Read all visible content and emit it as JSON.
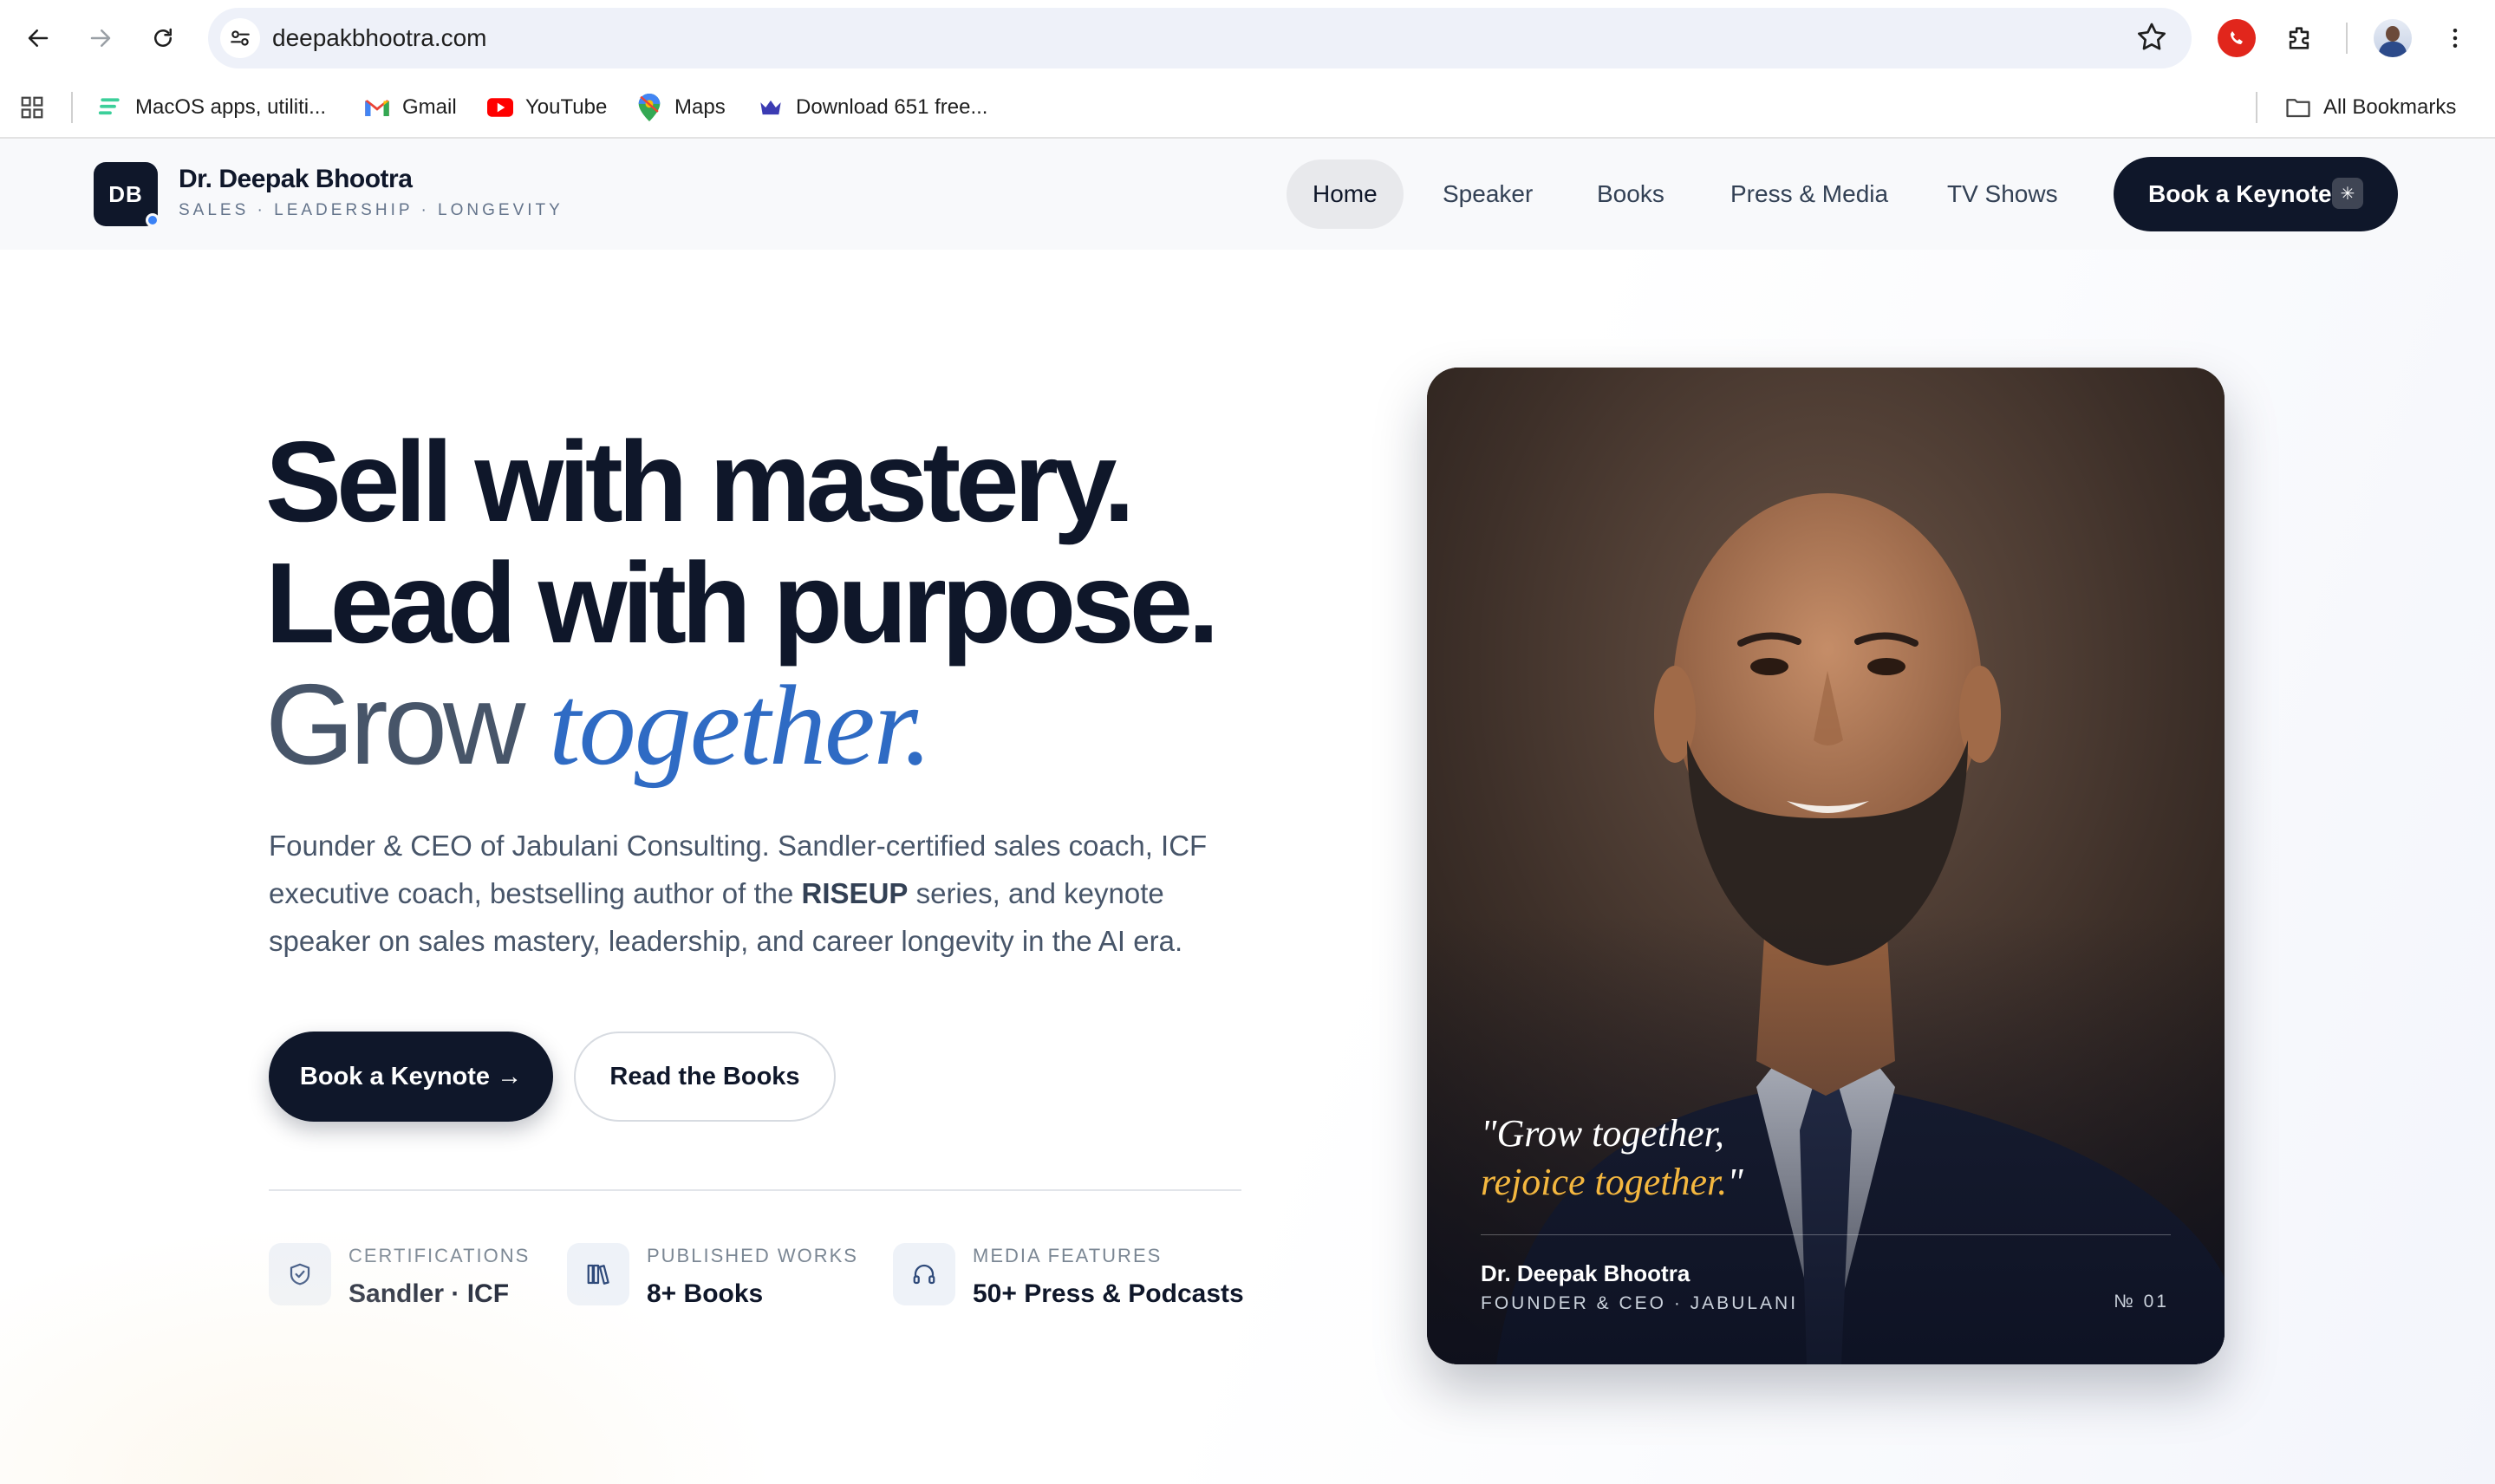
{
  "browser": {
    "url": "deepakbhootra.com",
    "bookmarks": [
      {
        "label": "MacOS apps, utiliti...",
        "icon": "setapp-icon"
      },
      {
        "label": "Gmail",
        "icon": "gmail-icon"
      },
      {
        "label": "YouTube",
        "icon": "youtube-icon"
      },
      {
        "label": "Maps",
        "icon": "maps-icon"
      },
      {
        "label": "Download 651 free...",
        "icon": "crown-icon"
      }
    ],
    "all_bookmarks": "All Bookmarks"
  },
  "site": {
    "logo": "DB",
    "name": "Dr. Deepak Bhootra",
    "tagline": "SALES · LEADERSHIP · LONGEVITY",
    "nav": [
      "Home",
      "Speaker",
      "Books",
      "Press & Media",
      "TV Shows"
    ],
    "nav_active": "Home",
    "cta": "Book a Keynote"
  },
  "hero": {
    "line1": "Sell with mastery.",
    "line2": "Lead with purpose.",
    "line3_plain": "Grow ",
    "line3_accent": "together.",
    "lede_before": "Founder & CEO of Jabulani Consulting. Sandler-certified sales coach, ICF executive coach, bestselling author of the ",
    "lede_bold": "RISEUP",
    "lede_after": " series, and keynote speaker on sales mastery, leadership, and career longevity in the AI era.",
    "primary_button": "Book a Keynote →",
    "secondary_button": "Read the Books",
    "stats": [
      {
        "label": "CERTIFICATIONS",
        "value": "Sandler · ICF",
        "icon": "shield-check-icon"
      },
      {
        "label": "PUBLISHED WORKS",
        "value": "8+ Books",
        "icon": "books-icon"
      },
      {
        "label": "MEDIA FEATURES",
        "value": "50+ Press & Podcasts",
        "icon": "headphones-icon"
      }
    ]
  },
  "card": {
    "quote_line1": "\"Grow together,",
    "quote_line2": "rejoice together.",
    "quote_close": "\"",
    "name": "Dr. Deepak Bhootra",
    "role": "FOUNDER & CEO · JABULANI",
    "number": "№ 01"
  },
  "colors": {
    "navy": "#0f172a",
    "accent_blue": "#2f6bc4",
    "gold": "#f4b73f"
  }
}
